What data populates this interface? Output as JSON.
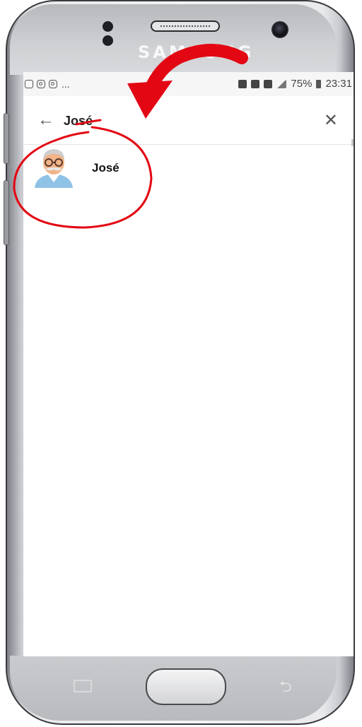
{
  "device": {
    "brand": "SAMSUNG"
  },
  "status_bar": {
    "left_dots": "...",
    "battery": "75%",
    "time": "23:31"
  },
  "search": {
    "query": "José"
  },
  "results": [
    {
      "name": "José",
      "avatar": "elderly-man-avatar"
    }
  ],
  "colors": {
    "annotation": "#e30613",
    "screen_bg": "#ffffff",
    "status_bg": "#f6f6f6"
  }
}
